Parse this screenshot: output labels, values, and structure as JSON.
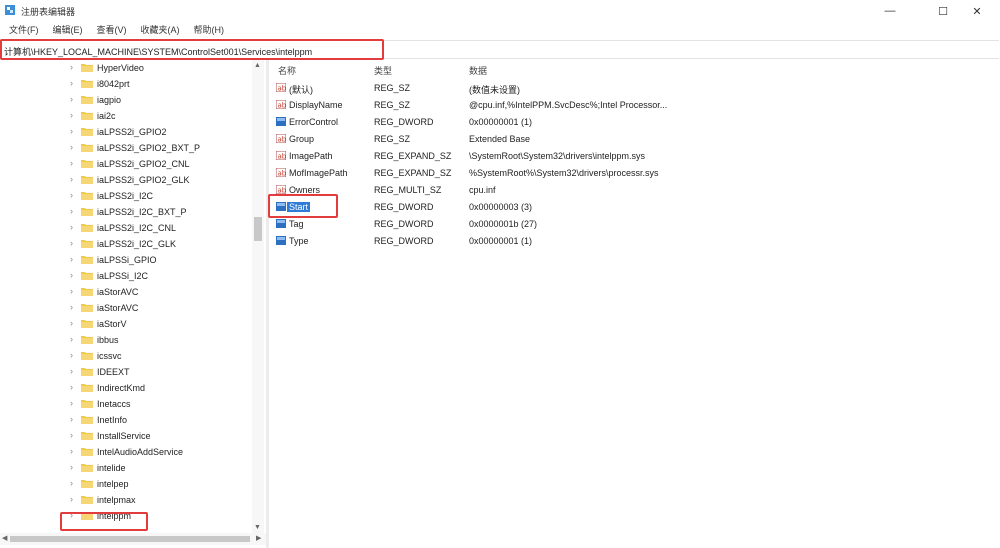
{
  "window": {
    "title": "注册表编辑器",
    "minimize": "—",
    "maximize": "☐",
    "close": "✕"
  },
  "menu": [
    "文件(F)",
    "编辑(E)",
    "查看(V)",
    "收藏夹(A)",
    "帮助(H)"
  ],
  "address": "计算机\\HKEY_LOCAL_MACHINE\\SYSTEM\\ControlSet001\\Services\\intelppm",
  "tree": [
    "HyperVideo",
    "i8042prt",
    "iagpio",
    "iai2c",
    "iaLPSS2i_GPIO2",
    "iaLPSS2i_GPIO2_BXT_P",
    "iaLPSS2i_GPIO2_CNL",
    "iaLPSS2i_GPIO2_GLK",
    "iaLPSS2i_I2C",
    "iaLPSS2i_I2C_BXT_P",
    "iaLPSS2i_I2C_CNL",
    "iaLPSS2i_I2C_GLK",
    "iaLPSSi_GPIO",
    "iaLPSSi_I2C",
    "iaStorAVC",
    "iaStorAVC",
    "iaStorV",
    "ibbus",
    "icssvc",
    "IDEEXT",
    "IndirectKmd",
    "Inetaccs",
    "InetInfo",
    "InstallService",
    "IntelAudioAddService",
    "intelide",
    "intelpep",
    "intelpmax",
    "intelppm"
  ],
  "list": {
    "headers": {
      "name": "名称",
      "type": "类型",
      "data": "数据"
    },
    "rows": [
      {
        "name": "(默认)",
        "type": "REG_SZ",
        "data": "(数值未设置)",
        "icon": "string-value-icon"
      },
      {
        "name": "DisplayName",
        "type": "REG_SZ",
        "data": "@cpu.inf,%IntelPPM.SvcDesc%;Intel Processor...",
        "icon": "string-value-icon"
      },
      {
        "name": "ErrorControl",
        "type": "REG_DWORD",
        "data": "0x00000001 (1)",
        "icon": "binary-value-icon"
      },
      {
        "name": "Group",
        "type": "REG_SZ",
        "data": "Extended Base",
        "icon": "string-value-icon"
      },
      {
        "name": "ImagePath",
        "type": "REG_EXPAND_SZ",
        "data": "\\SystemRoot\\System32\\drivers\\intelppm.sys",
        "icon": "string-value-icon"
      },
      {
        "name": "MofImagePath",
        "type": "REG_EXPAND_SZ",
        "data": "%SystemRoot%\\System32\\drivers\\processr.sys",
        "icon": "string-value-icon"
      },
      {
        "name": "Owners",
        "type": "REG_MULTI_SZ",
        "data": "cpu.inf",
        "icon": "string-value-icon"
      },
      {
        "name": "Start",
        "type": "REG_DWORD",
        "data": "0x00000003 (3)",
        "icon": "binary-value-icon"
      },
      {
        "name": "Tag",
        "type": "REG_DWORD",
        "data": "0x0000001b (27)",
        "icon": "binary-value-icon"
      },
      {
        "name": "Type",
        "type": "REG_DWORD",
        "data": "0x00000001 (1)",
        "icon": "binary-value-icon"
      }
    ]
  },
  "colors": {
    "highlight_box": "#e23c3c",
    "selection": "#2f7bd8",
    "folder": "#f2c94c"
  }
}
